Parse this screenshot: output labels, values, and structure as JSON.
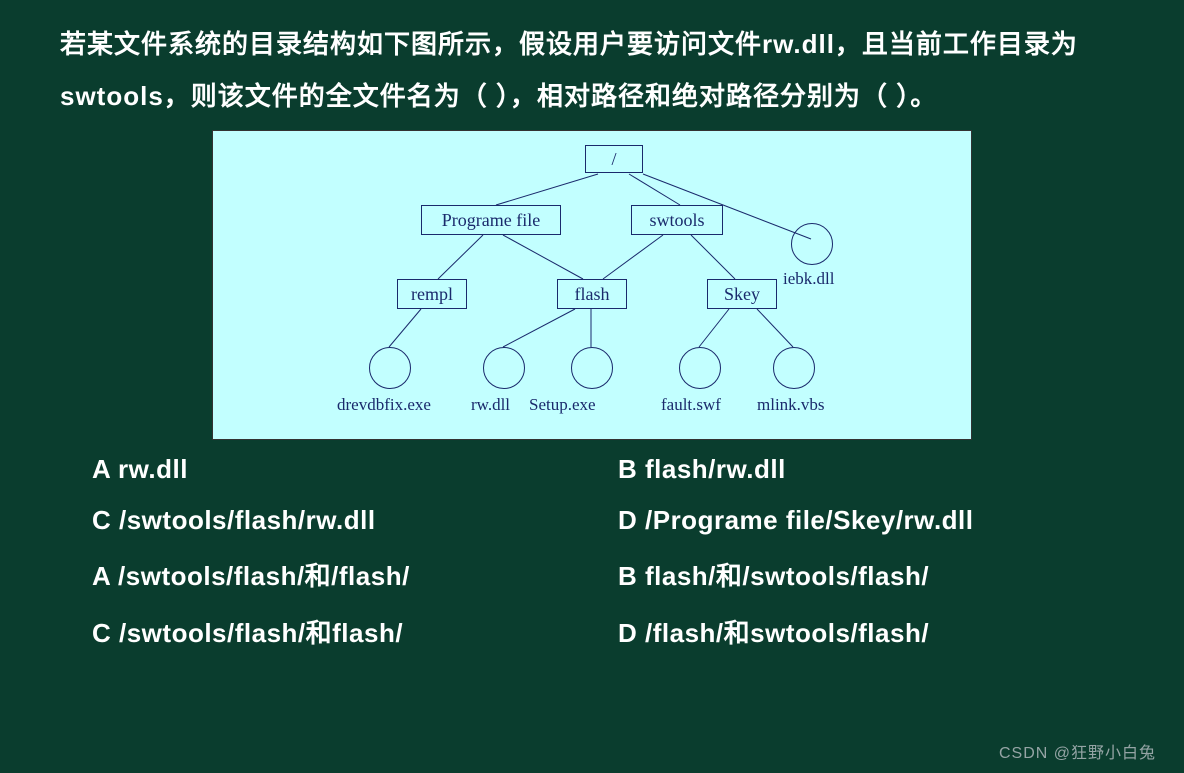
{
  "question": {
    "text": "若某文件系统的目录结构如下图所示，假设用户要访问文件rw.dll，且当前工作目录为swtools，则该文件的全文件名为（ ），相对路径和绝对路径分别为（ ）。"
  },
  "diagram": {
    "root": "/",
    "level2": {
      "left": "Programe file",
      "mid": "swtools"
    },
    "iebk": "iebk.dll",
    "level3": {
      "rempl": "rempl",
      "flash": "flash",
      "skey": "Skey"
    },
    "leaves": {
      "drevdbfix": "drevdbfix.exe",
      "rwdll": "rw.dll",
      "setup": "Setup.exe",
      "fault": "fault.swf",
      "mlink": "mlink.vbs"
    }
  },
  "options": {
    "q1A": "A rw.dll",
    "q1B": "B flash/rw.dll",
    "q1C": "C /swtools/flash/rw.dll",
    "q1D": "D /Programe file/Skey/rw.dll",
    "q2A": "A /swtools/flash/和/flash/",
    "q2B": "B flash/和/swtools/flash/",
    "q2C": "C /swtools/flash/和flash/",
    "q2D": "D /flash/和swtools/flash/"
  },
  "watermark": "CSDN @狂野小白兔"
}
